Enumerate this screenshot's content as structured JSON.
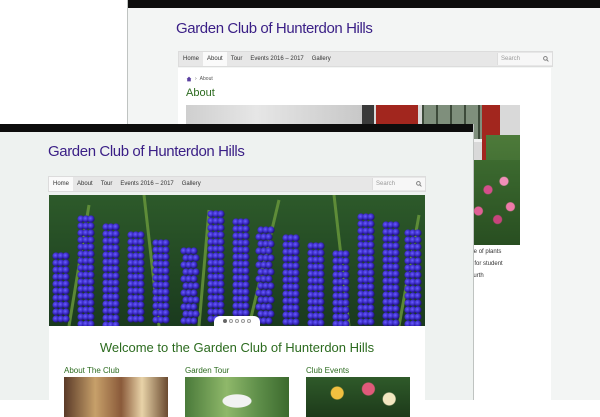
{
  "back_window": {
    "site_title": "Garden Club of Hunterdon Hills",
    "nav": [
      "Home",
      "About",
      "Tour",
      "Events 2016 – 2017",
      "Gallery"
    ],
    "active_nav": "About",
    "search_placeholder": "Search",
    "breadcrumb": {
      "current": "About"
    },
    "page_heading": "About",
    "body_lines": [
      "eir knowledge of plants",
      "raise money for student",
      "ps are the fourth"
    ]
  },
  "front_window": {
    "site_title": "Garden Club of Hunterdon Hills",
    "nav": [
      "Home",
      "About",
      "Tour",
      "Events 2016 – 2017",
      "Gallery"
    ],
    "active_nav": "Home",
    "search_placeholder": "Search",
    "slider": {
      "slides": 5,
      "active_slide": 1
    },
    "welcome_heading": "Welcome to the Garden Club of Hunterdon Hills",
    "columns": [
      {
        "title": "About The Club"
      },
      {
        "title": "Garden Tour"
      },
      {
        "title": "Club Events"
      }
    ]
  },
  "colors": {
    "title": "#3a1f86",
    "heading_green": "#2c6b1f",
    "top_bar": "#0d0d0d"
  },
  "icons": {
    "home": "home-icon",
    "search": "search-icon",
    "breadcrumb_separator": "chevron-right-icon"
  }
}
